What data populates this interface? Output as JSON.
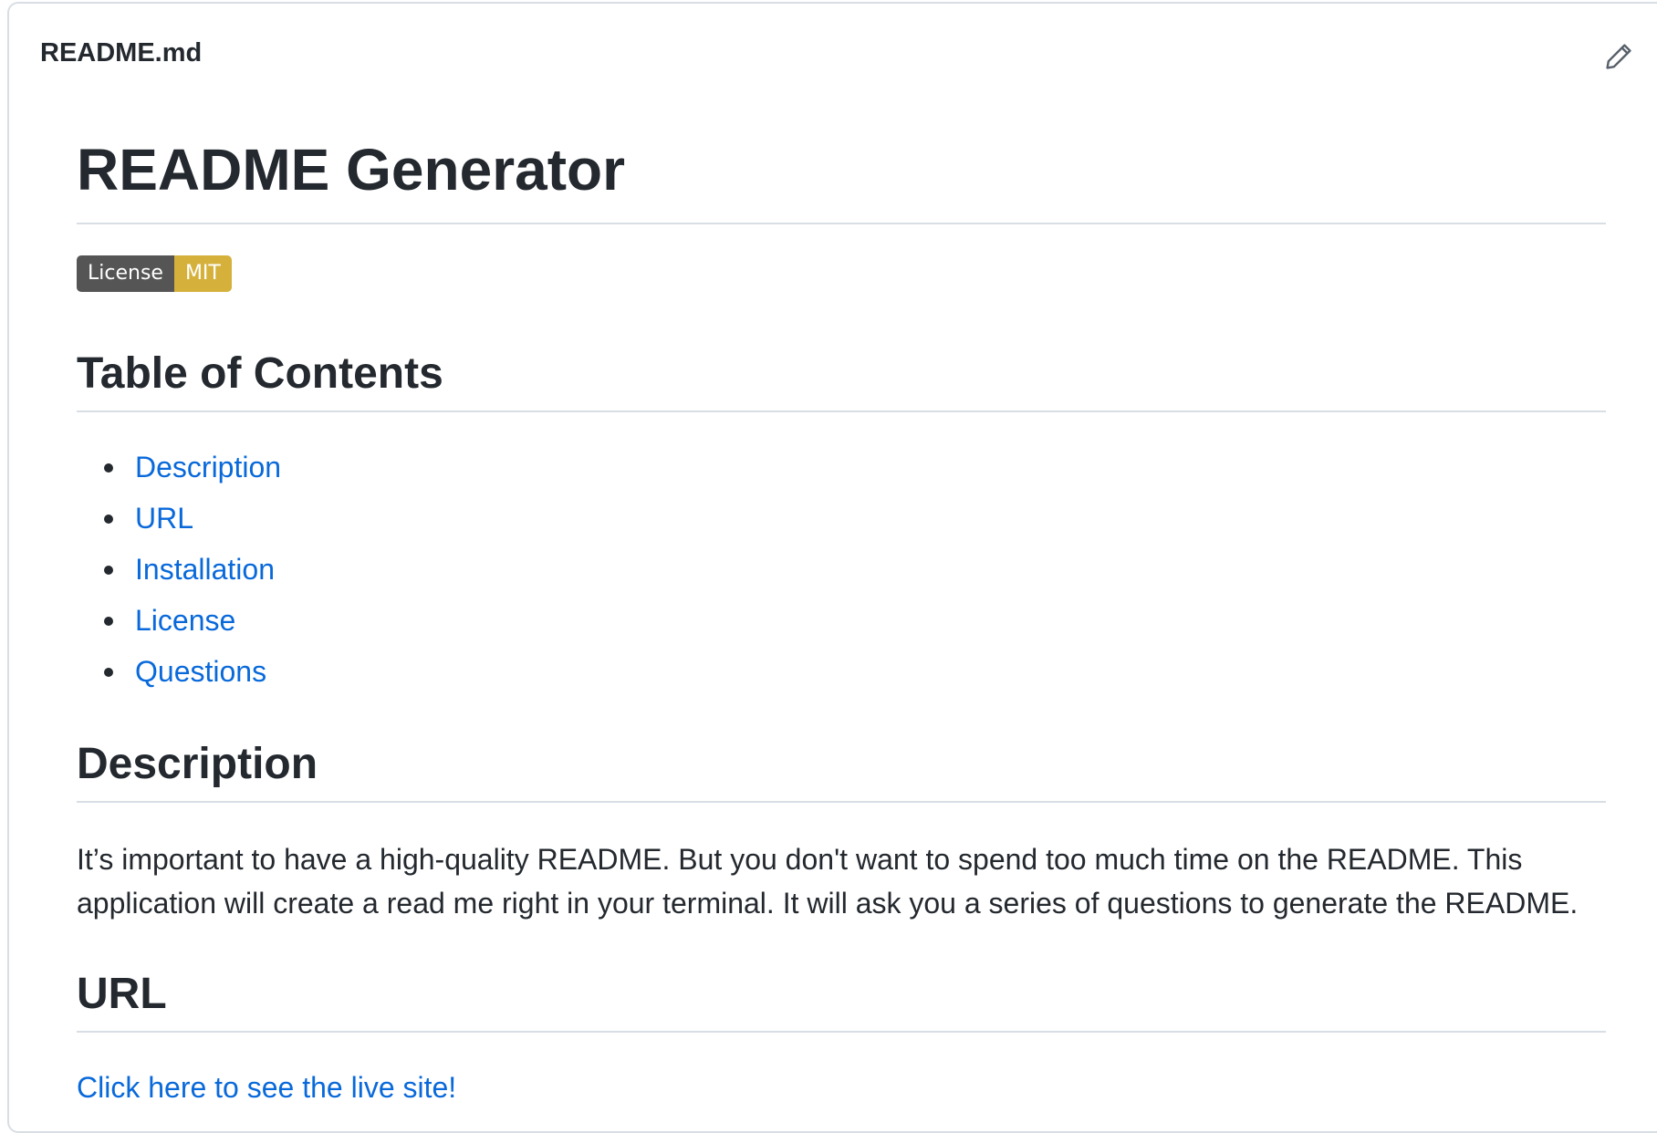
{
  "file": {
    "name": "README.md",
    "edit_icon": "pencil-icon"
  },
  "readme": {
    "title": "README Generator",
    "badge": {
      "label": "License",
      "value": "MIT",
      "label_color": "#555555",
      "value_color": "#d5b13c"
    },
    "toc_heading": "Table of Contents",
    "toc": [
      "Description",
      "URL",
      "Installation",
      "License",
      "Questions"
    ],
    "description_heading": "Description",
    "description_text": "It’s important to have a high-quality README. But you don't want to spend too much time on the README. This application will create a read me right in your terminal. It will ask you a series of questions to generate the README.",
    "url_heading": "URL",
    "url_link": "Click here to see the live site!"
  },
  "colors": {
    "link": "#0969da",
    "text": "#24292f",
    "border": "#d8dee4"
  }
}
